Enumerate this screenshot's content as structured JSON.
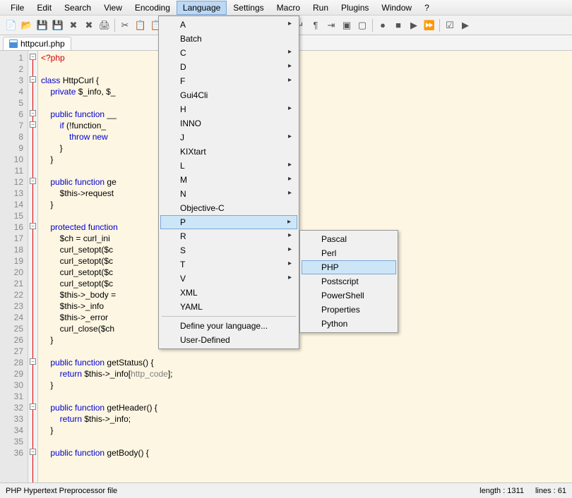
{
  "menubar": [
    "File",
    "Edit",
    "Search",
    "View",
    "Encoding",
    "Language",
    "Settings",
    "Macro",
    "Run",
    "Plugins",
    "Window",
    "?"
  ],
  "menubar_active_index": 5,
  "tab": {
    "label": "httpcurl.php"
  },
  "lang_menu": {
    "items": [
      {
        "label": "A",
        "sub": true
      },
      {
        "label": "Batch",
        "sub": false
      },
      {
        "label": "C",
        "sub": true
      },
      {
        "label": "D",
        "sub": true
      },
      {
        "label": "F",
        "sub": true
      },
      {
        "label": "Gui4Cli",
        "sub": false
      },
      {
        "label": "H",
        "sub": true
      },
      {
        "label": "INNO",
        "sub": false
      },
      {
        "label": "J",
        "sub": true
      },
      {
        "label": "KIXtart",
        "sub": false
      },
      {
        "label": "L",
        "sub": true
      },
      {
        "label": "M",
        "sub": true
      },
      {
        "label": "N",
        "sub": true
      },
      {
        "label": "Objective-C",
        "sub": false
      },
      {
        "label": "P",
        "sub": true,
        "hi": true
      },
      {
        "label": "R",
        "sub": true
      },
      {
        "label": "S",
        "sub": true
      },
      {
        "label": "T",
        "sub": true
      },
      {
        "label": "V",
        "sub": true
      },
      {
        "label": "XML",
        "sub": false
      },
      {
        "label": "YAML",
        "sub": false
      }
    ],
    "footer": [
      "Define your language...",
      "User-Defined"
    ]
  },
  "p_submenu": [
    {
      "label": "Pascal"
    },
    {
      "label": "Perl"
    },
    {
      "label": "PHP",
      "hi": true
    },
    {
      "label": "Postscript"
    },
    {
      "label": "PowerShell"
    },
    {
      "label": "Properties"
    },
    {
      "label": "Python"
    }
  ],
  "code_lines": [
    {
      "n": 1,
      "html": "<span class='php'>&lt;?php</span>"
    },
    {
      "n": 2,
      "html": ""
    },
    {
      "n": 3,
      "html": "<span class='kw'>class</span> <span class='cls'>HttpCurl</span> {"
    },
    {
      "n": 4,
      "html": "    <span class='kw'>private</span> <span class='var'>$_info</span>, <span class='var'>$_</span>"
    },
    {
      "n": 5,
      "html": ""
    },
    {
      "n": 6,
      "html": "    <span class='kw'>public</span> <span class='kw'>function</span> <span class='fn'>__</span>"
    },
    {
      "n": 7,
      "html": "        <span class='kw'>if</span> (!<span class='fn'>function_</span>"
    },
    {
      "n": 8,
      "html": "            <span class='kw'>throw</span> <span class='kw'>new</span> "
    },
    {
      "n": 9,
      "html": "        }"
    },
    {
      "n": 10,
      "html": "    }"
    },
    {
      "n": 11,
      "html": ""
    },
    {
      "n": 12,
      "html": "    <span class='kw'>public</span> <span class='kw'>function</span> <span class='fn'>ge</span>"
    },
    {
      "n": 13,
      "html": "        <span class='var'>$this</span>-&gt;<span class='fn'>request</span>"
    },
    {
      "n": 14,
      "html": "    }"
    },
    {
      "n": 15,
      "html": ""
    },
    {
      "n": 16,
      "html": "    <span class='kw'>protected</span> <span class='kw'>function</span>"
    },
    {
      "n": 17,
      "html": "        <span class='var'>$ch</span> = <span class='fn'>curl_ini</span>"
    },
    {
      "n": 18,
      "html": "        <span class='fn'>curl_setopt</span>(<span class='var'>$c</span>"
    },
    {
      "n": 19,
      "html": "        <span class='fn'>curl_setopt</span>(<span class='var'>$c</span>"
    },
    {
      "n": 20,
      "html": "        <span class='fn'>curl_setopt</span>(<span class='var'>$c</span>"
    },
    {
      "n": 21,
      "html": "        <span class='fn'>curl_setopt</span>(<span class='var'>$c</span>"
    },
    {
      "n": 22,
      "html": "        <span class='var'>$this</span>-&gt;<span class='fn'>_body</span> ="
    },
    {
      "n": 23,
      "html": "        <span class='var'>$this</span>-&gt;<span class='fn'>_info</span> "
    },
    {
      "n": 24,
      "html": "        <span class='var'>$this</span>-&gt;<span class='fn'>_error</span> "
    },
    {
      "n": 25,
      "html": "        <span class='fn'>curl_close</span>(<span class='var'>$ch</span>"
    },
    {
      "n": 26,
      "html": "    }"
    },
    {
      "n": 27,
      "html": ""
    },
    {
      "n": 28,
      "html": "    <span class='kw'>public</span> <span class='kw'>function</span> <span class='fn'>getStatus</span>() {"
    },
    {
      "n": 29,
      "html": "        <span class='kw'>return</span> <span class='var'>$this</span>-&gt;<span class='fn'>_info</span>[<span class='str'>http_code</span>];"
    },
    {
      "n": 30,
      "html": "    }"
    },
    {
      "n": 31,
      "html": ""
    },
    {
      "n": 32,
      "html": "    <span class='kw'>public</span> <span class='kw'>function</span> <span class='fn'>getHeader</span>() {"
    },
    {
      "n": 33,
      "html": "        <span class='kw'>return</span> <span class='var'>$this</span>-&gt;<span class='fn'>_info</span>;"
    },
    {
      "n": 34,
      "html": "    }"
    },
    {
      "n": 35,
      "html": ""
    },
    {
      "n": 36,
      "html": "    <span class='kw'>public</span> <span class='kw'>function</span> <span class='fn'>getBody</span>() {"
    }
  ],
  "fold_markers": [
    1,
    3,
    6,
    7,
    12,
    16,
    28,
    32,
    36
  ],
  "status": {
    "left": "PHP Hypertext Preprocessor file",
    "length": "length : 1311",
    "lines": "lines : 61"
  },
  "toolbar_icons": [
    "new",
    "open",
    "save",
    "save-all",
    "close",
    "close-all",
    "print",
    "",
    "cut",
    "copy",
    "paste",
    "",
    "undo",
    "redo",
    "",
    "find",
    "replace",
    "",
    "zoom-in",
    "zoom-out",
    "",
    "sync",
    "wrap",
    "all-chars",
    "indent",
    "fold",
    "unfold",
    "",
    "record",
    "stop",
    "play",
    "fast",
    "",
    "toggle",
    "run"
  ]
}
